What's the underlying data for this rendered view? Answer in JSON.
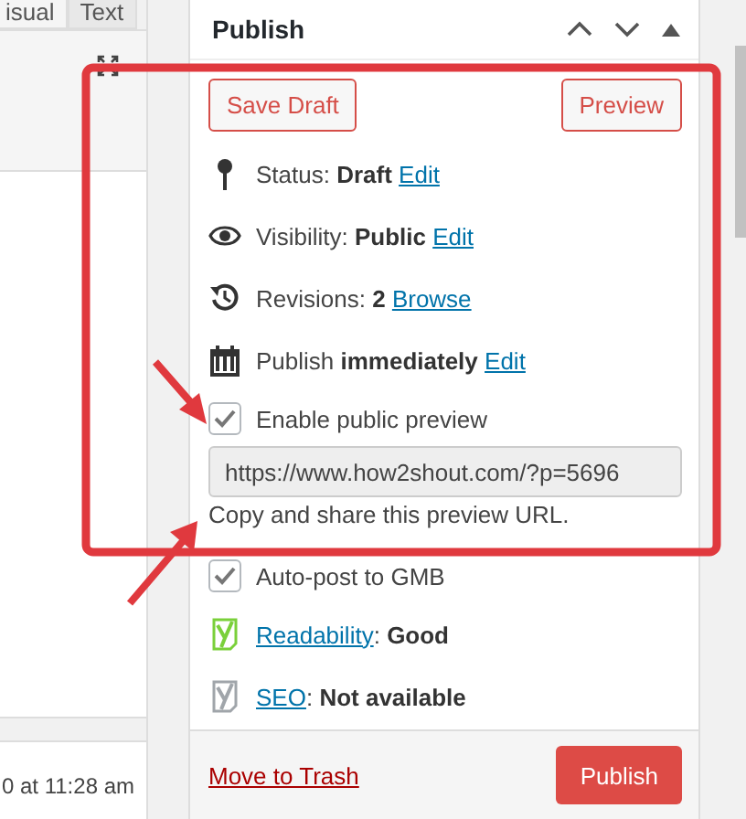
{
  "editor": {
    "tabs": [
      {
        "label": "isual",
        "selected": true
      },
      {
        "label": "Text",
        "selected": false
      }
    ],
    "timestamp": "0 at 11:28 am"
  },
  "publish_box": {
    "title": "Publish",
    "save_button": "Save Draft",
    "preview_button": "Preview",
    "rows": [
      {
        "kind": "status",
        "label": "Status:",
        "value": "Draft",
        "link": "Edit"
      },
      {
        "kind": "visibility",
        "label": "Visibility:",
        "value": "Public",
        "link": "Edit"
      },
      {
        "kind": "revisions",
        "label": "Revisions:",
        "value": "2",
        "link": "Browse"
      },
      {
        "kind": "schedule",
        "label": "Publish",
        "value": "immediately",
        "link": "Edit"
      }
    ],
    "public_preview": {
      "label": "Enable public preview",
      "checked": true,
      "url": "https://www.how2shout.com/?p=5696",
      "note": "Copy and share this preview URL."
    },
    "auto_post": {
      "label": "Auto-post to GMB",
      "checked": true
    },
    "scores": [
      {
        "link": "Readability",
        "separator": ":",
        "value": "Good",
        "color": "#7ad03a"
      },
      {
        "link": "SEO",
        "separator": ":",
        "value": "Not available",
        "color": "#a0a5aa"
      }
    ],
    "trash_link": "Move to Trash",
    "publish_button": "Publish"
  }
}
